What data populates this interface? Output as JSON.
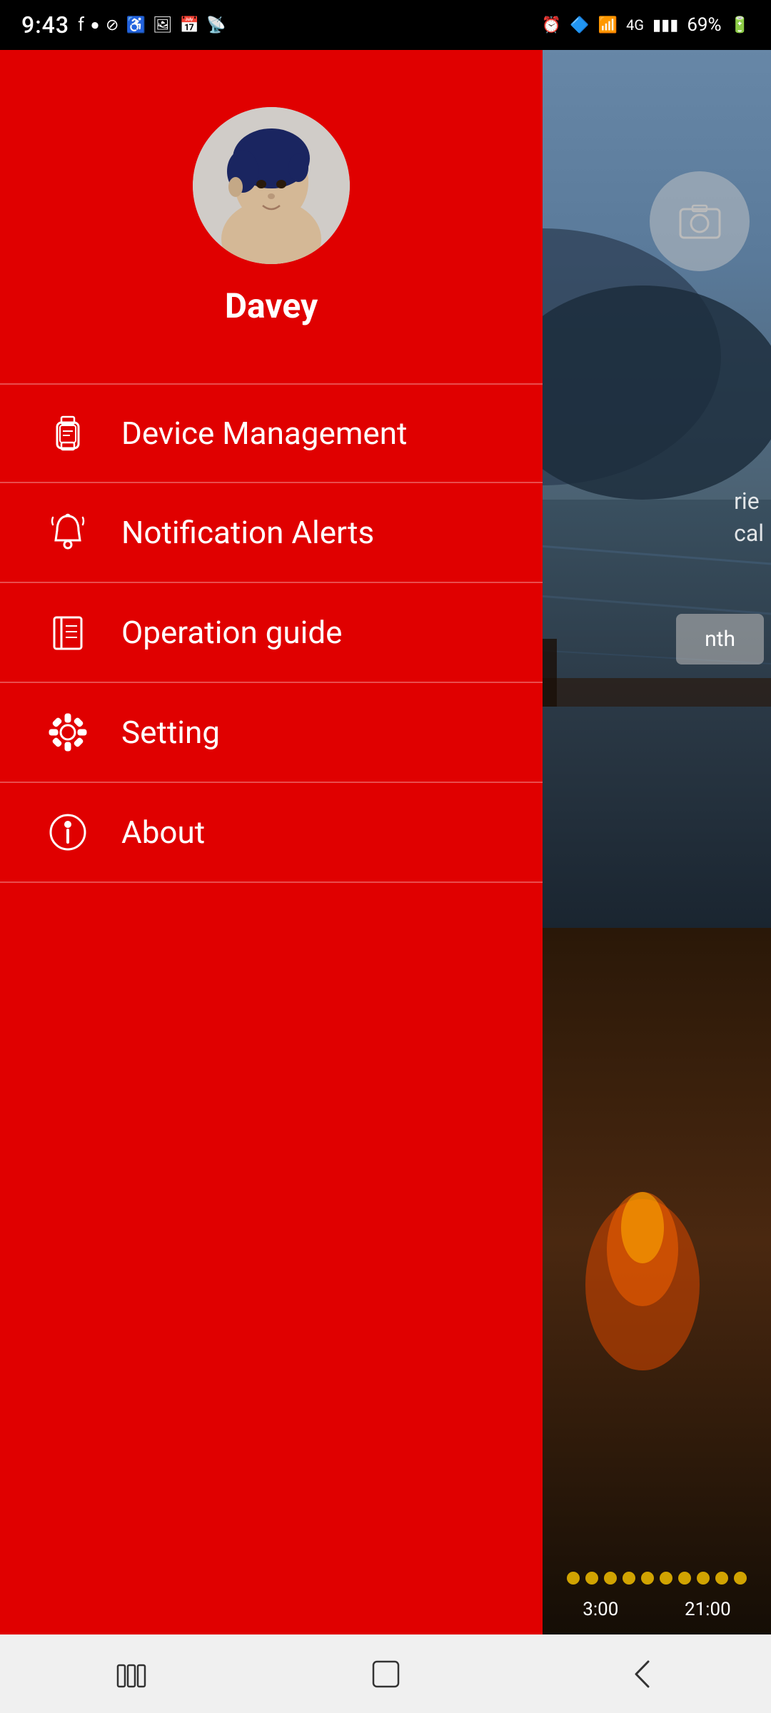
{
  "statusBar": {
    "time": "9:43",
    "battery": "69%",
    "leftIcons": [
      "facebook-icon",
      "recorder-icon",
      "dnd-icon",
      "accessibility-icon",
      "gallery-icon",
      "calendar-icon",
      "cast-icon"
    ],
    "rightIcons": [
      "alarm-icon",
      "bluetooth-icon",
      "wifi-icon",
      "signal-icon",
      "battery-icon"
    ]
  },
  "drawer": {
    "profile": {
      "name": "Davey"
    },
    "menuItems": [
      {
        "id": "device-management",
        "label": "Device Management",
        "icon": "watch-icon"
      },
      {
        "id": "notification-alerts",
        "label": "Notification Alerts",
        "icon": "bell-icon"
      },
      {
        "id": "operation-guide",
        "label": "Operation guide",
        "icon": "book-icon"
      },
      {
        "id": "setting",
        "label": "Setting",
        "icon": "gear-icon"
      },
      {
        "id": "about",
        "label": "About",
        "icon": "info-icon"
      }
    ]
  },
  "rightPanel": {
    "rightText1": "rie",
    "rightText2": "cal",
    "monthLabel": "nth",
    "timelineTimesLeft": "3:00",
    "timelineTimesRight": "21:00"
  },
  "bottomNav": {
    "recentBtn": "recent-apps",
    "homeBtn": "home",
    "backBtn": "back"
  }
}
